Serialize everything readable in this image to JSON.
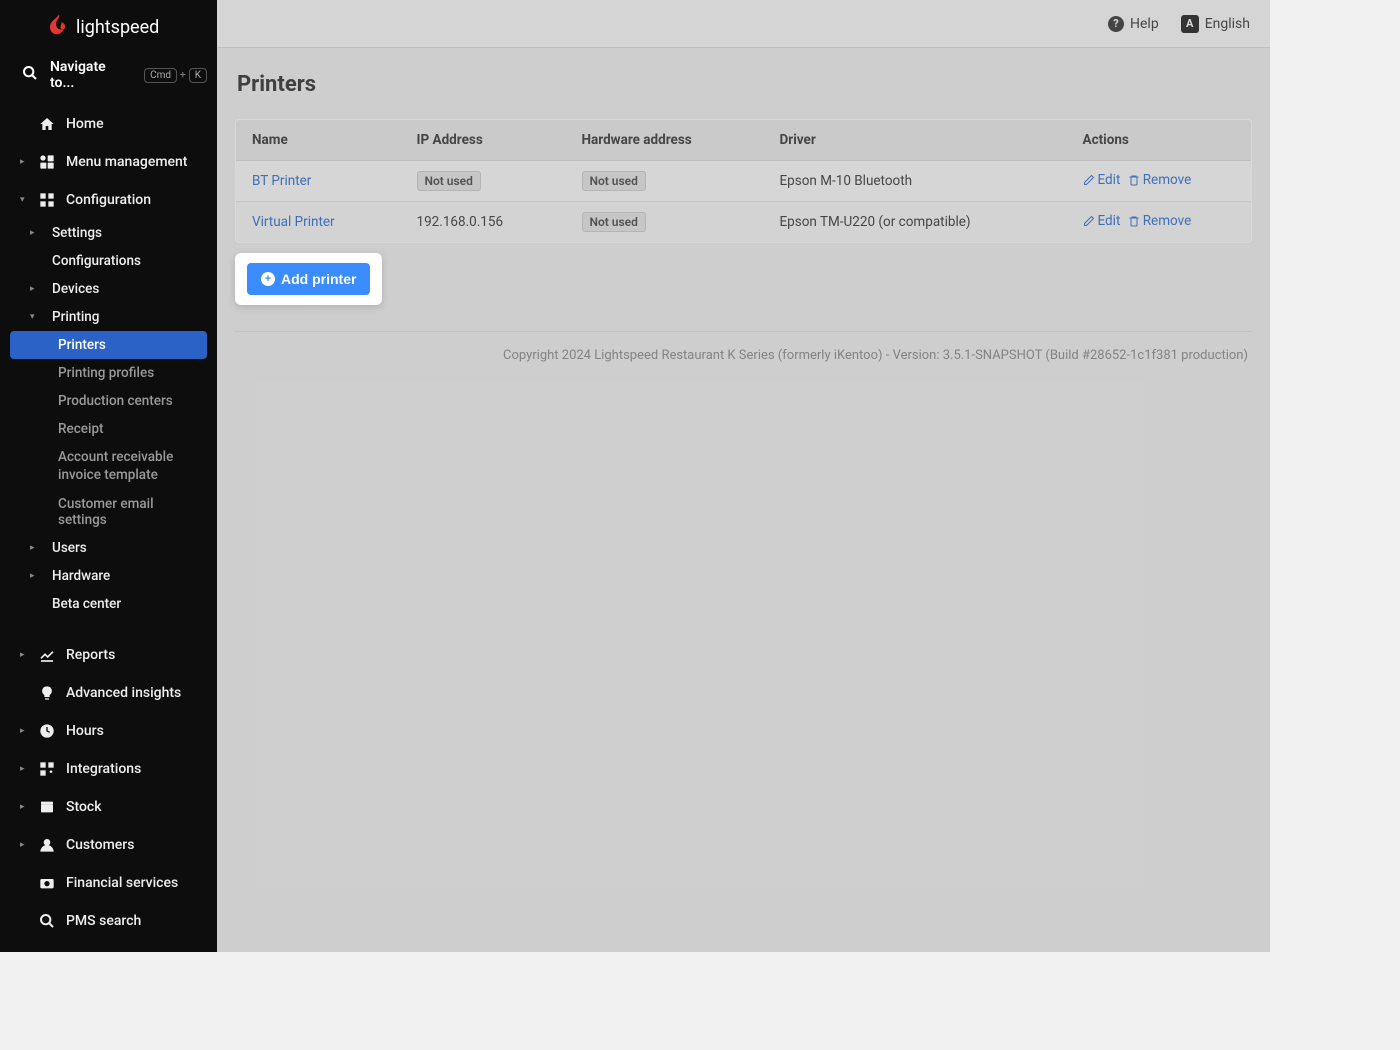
{
  "brand": "lightspeed",
  "search": {
    "label": "Navigate to...",
    "kbd1": "Cmd",
    "kbd2": "K"
  },
  "topbar": {
    "help": "Help",
    "language": "English",
    "langLetter": "A"
  },
  "sidebar": {
    "home": "Home",
    "menuMgmt": "Menu management",
    "configuration": "Configuration",
    "settings": "Settings",
    "configurations": "Configurations",
    "devices": "Devices",
    "printing": "Printing",
    "printers": "Printers",
    "printingProfiles": "Printing profiles",
    "productionCenters": "Production centers",
    "receipt": "Receipt",
    "arTemplate": "Account receivable invoice template",
    "emailSettings": "Customer email settings",
    "users": "Users",
    "hardware": "Hardware",
    "betaCenter": "Beta center",
    "reports": "Reports",
    "advancedInsights": "Advanced insights",
    "hours": "Hours",
    "integrations": "Integrations",
    "stock": "Stock",
    "customers": "Customers",
    "financialServices": "Financial services",
    "pmsSearch": "PMS search"
  },
  "page": {
    "title": "Printers",
    "columns": {
      "name": "Name",
      "ip": "IP Address",
      "hw": "Hardware address",
      "driver": "Driver",
      "actions": "Actions"
    },
    "notUsed": "Not used",
    "edit": "Edit",
    "remove": "Remove",
    "addPrinter": "Add printer",
    "rows": [
      {
        "name": "BT Printer",
        "ip": "",
        "ip_badge": true,
        "hw_badge": true,
        "driver": "Epson M-10 Bluetooth"
      },
      {
        "name": "Virtual Printer",
        "ip": "192.168.0.156",
        "ip_badge": false,
        "hw_badge": true,
        "driver": "Epson TM-U220 (or compatible)"
      }
    ]
  },
  "footer": "Copyright 2024 Lightspeed Restaurant K Series (formerly iKentoo) - Version: 3.5.1-SNAPSHOT (Build #28652-1c1f381 production)"
}
